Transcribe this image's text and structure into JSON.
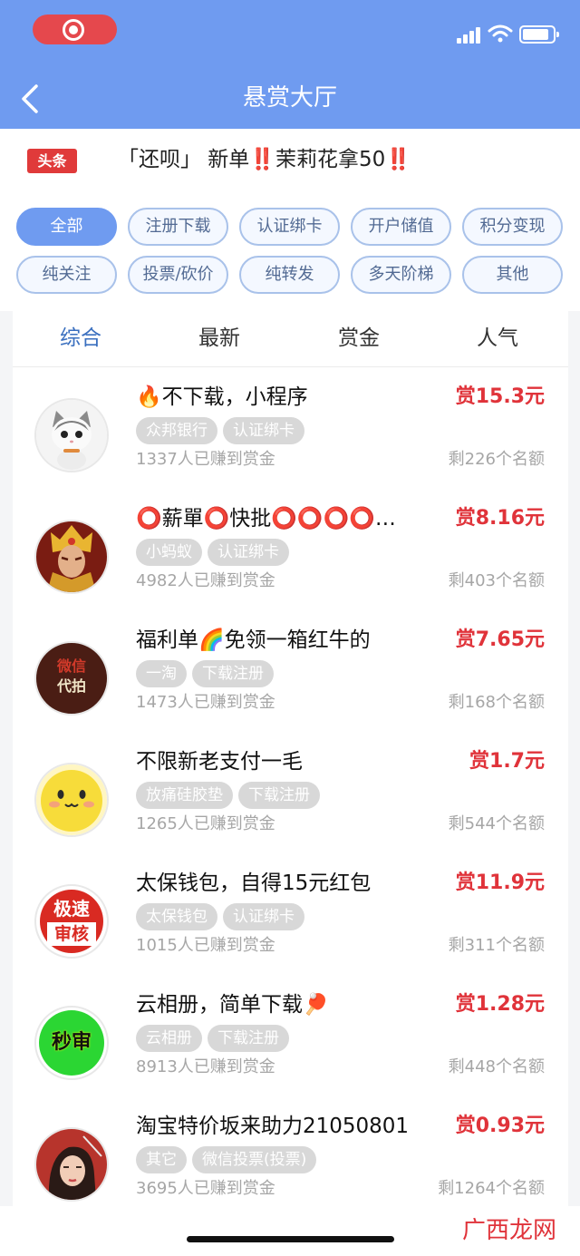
{
  "header": {
    "title": "悬赏大厅",
    "back_icon": "chevron-left-icon"
  },
  "news": {
    "tag": "头条",
    "text": "「还呗」 新单‼️茉莉花拿50‼️"
  },
  "filters": [
    {
      "label": "全部",
      "active": true
    },
    {
      "label": "注册下载"
    },
    {
      "label": "认证绑卡"
    },
    {
      "label": "开户储值"
    },
    {
      "label": "积分变现"
    },
    {
      "label": "纯关注"
    },
    {
      "label": "投票/砍价"
    },
    {
      "label": "纯转发"
    },
    {
      "label": "多天阶梯"
    },
    {
      "label": "其他"
    }
  ],
  "sort_tabs": [
    {
      "label": "综合",
      "active": true
    },
    {
      "label": "最新"
    },
    {
      "label": "赏金"
    },
    {
      "label": "人气"
    }
  ],
  "tasks": [
    {
      "title": "🔥不下载，小程序",
      "reward": "赏15.3元",
      "tags": [
        "众邦银行",
        "认证绑卡"
      ],
      "earned": "1337人已赚到赏金",
      "remaining": "剩226个名额",
      "avatar": "kitten-avatar"
    },
    {
      "title": "⭕薪單⭕快批⭕⭕⭕⭕…",
      "reward": "赏8.16元",
      "tags": [
        "小蚂蚁",
        "认证绑卡"
      ],
      "earned": "4982人已赚到赏金",
      "remaining": "剩403个名额",
      "avatar": "warrior-avatar"
    },
    {
      "title": "福利单🌈免领一箱红牛的",
      "reward": "赏7.65元",
      "tags": [
        "一淘",
        "下载注册"
      ],
      "earned": "1473人已赚到赏金",
      "remaining": "剩168个名额",
      "avatar": "daipai-avatar",
      "avatar_text": [
        "微信",
        "代拍"
      ]
    },
    {
      "title": "不限新老支付一毛",
      "reward": "赏1.7元",
      "tags": [
        "放痛硅胶垫",
        "下载注册"
      ],
      "earned": "1265人已赚到赏金",
      "remaining": "剩544个名额",
      "avatar": "smiley-avatar"
    },
    {
      "title": "太保钱包，自得15元红包",
      "reward": "赏11.9元",
      "tags": [
        "太保钱包",
        "认证绑卡"
      ],
      "earned": "1015人已赚到赏金",
      "remaining": "剩311个名额",
      "avatar": "jisu-avatar",
      "avatar_text": [
        "极速",
        "审核"
      ]
    },
    {
      "title": "云相册，简单下载🏓",
      "reward": "赏1.28元",
      "tags": [
        "云相册",
        "下载注册"
      ],
      "earned": "8913人已赚到赏金",
      "remaining": "剩448个名额",
      "avatar": "miaoshen-avatar",
      "avatar_text": [
        "秒审"
      ]
    },
    {
      "title": "淘宝特价坂来助力21050801",
      "reward": "赏0.93元",
      "tags": [
        "其它",
        "微信投票(投票)"
      ],
      "earned": "3695人已赚到赏金",
      "remaining": "剩1264个名额",
      "avatar": "portrait-avatar"
    }
  ],
  "watermark": "广西龙网",
  "colors": {
    "header": "#6f9bf0",
    "reward": "#e0333a",
    "chip_border": "#a9c2ea"
  }
}
